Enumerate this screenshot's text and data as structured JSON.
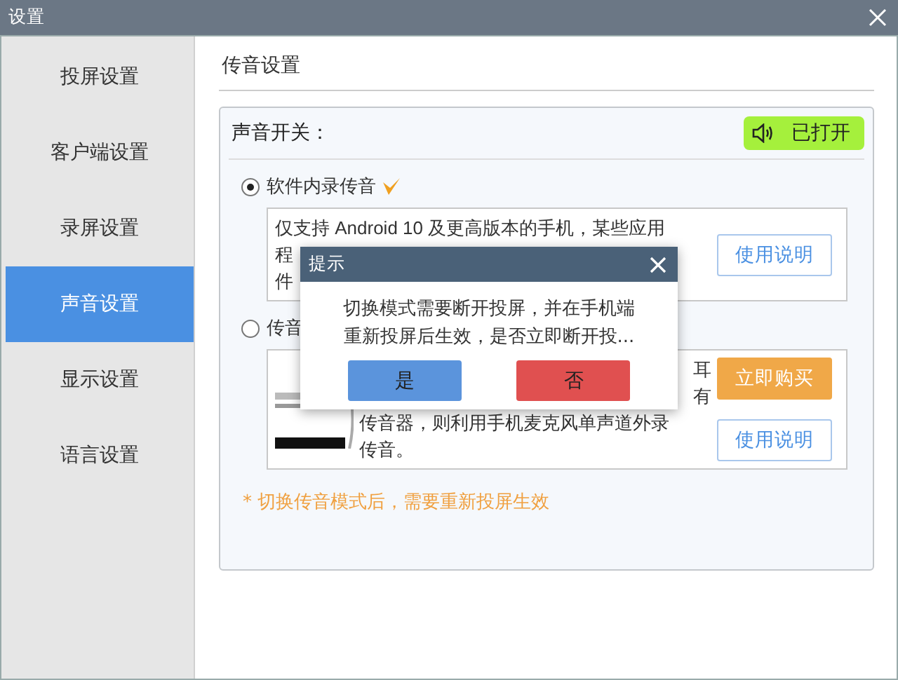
{
  "window": {
    "title": "设置"
  },
  "sidebar": {
    "items": [
      {
        "label": "投屏设置",
        "selected": false
      },
      {
        "label": "客户端设置",
        "selected": false
      },
      {
        "label": "录屏设置",
        "selected": false
      },
      {
        "label": "声音设置",
        "selected": true
      },
      {
        "label": "显示设置",
        "selected": false
      },
      {
        "label": "语言设置",
        "selected": false
      }
    ]
  },
  "page": {
    "title": "传音设置"
  },
  "sound_switch": {
    "label": "声音开关：",
    "button": "已打开",
    "on": true
  },
  "modes": [
    {
      "label": "软件内录传音",
      "selected": true,
      "recommended": true,
      "lines": [
        {
          "text": "仅支持 Android 10 及更高版本的手机，某些应用",
          "hidden_start": false
        },
        {
          "text": "程",
          "hidden_start": false
        },
        {
          "text": "件",
          "hidden_start": false
        }
      ],
      "buttons": [
        {
          "label": "使用说明",
          "kind": "outline"
        }
      ]
    },
    {
      "label": "传音",
      "selected": false,
      "recommended": false,
      "image": {
        "kind": "picture"
      },
      "lines": [
        {
          "text": "耳",
          "hidden_start": true
        },
        {
          "text": "有",
          "hidden_start": true
        },
        {
          "text": "传音器，则利用手机麦克风单声道外录",
          "hidden_start": false
        },
        {
          "text": "传音。",
          "hidden_start": false
        }
      ],
      "buttons": [
        {
          "label": "立即购买",
          "kind": "primary"
        },
        {
          "label": "使用说明",
          "kind": "outline"
        }
      ]
    }
  ],
  "note": "* 切换传音模式后，需要重新投屏生效",
  "dialog": {
    "title": "提示",
    "message": [
      "切换模式需要断开投屏，并在手机端",
      "重新投屏后生效，是否立即断开投..."
    ],
    "buttons": [
      {
        "label": "是",
        "kind": "confirm"
      },
      {
        "label": "否",
        "kind": "cancel"
      }
    ]
  }
}
